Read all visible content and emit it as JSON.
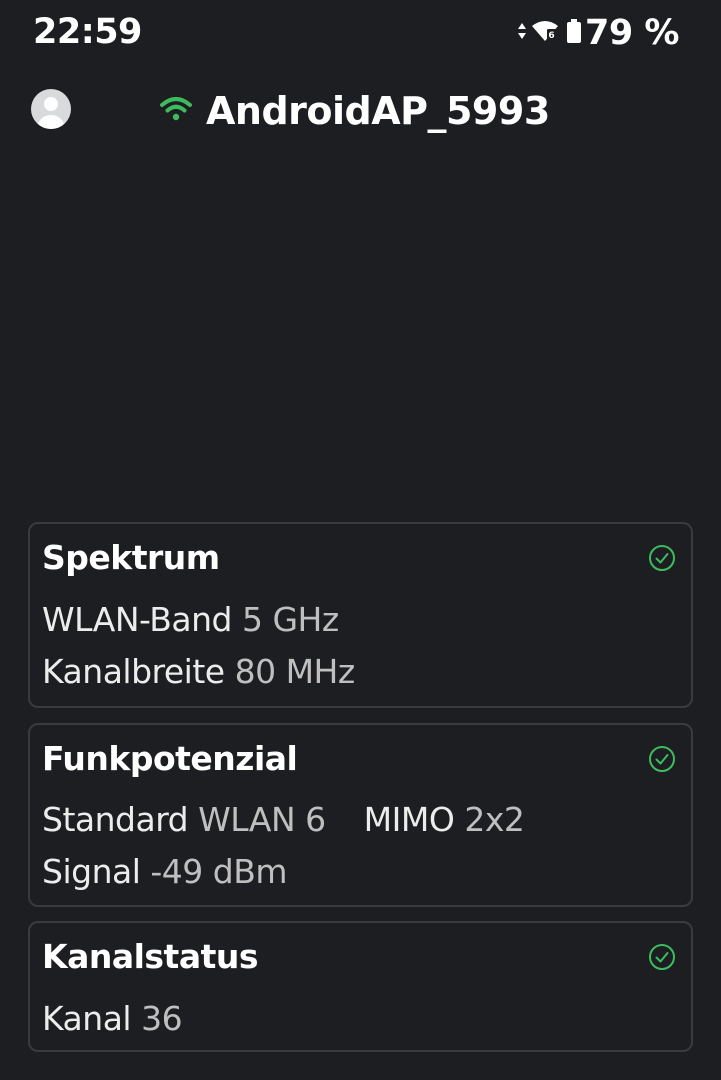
{
  "status_bar": {
    "time": "22:59",
    "battery": "79 %",
    "icons": [
      "data-arrows-icon",
      "wifi-6-icon",
      "battery-icon"
    ]
  },
  "header": {
    "ssid": "AndroidAP_5993",
    "wifi_color": "#3dbb5f"
  },
  "cards": {
    "spectrum": {
      "title": "Spektrum",
      "band_label": "WLAN-Band",
      "band_value": "5 GHz",
      "width_label": "Kanalbreite",
      "width_value": "80 MHz"
    },
    "radio": {
      "title": "Funkpotenzial",
      "standard_label": "Standard",
      "standard_value": "WLAN 6",
      "mimo_label": "MIMO",
      "mimo_value": "2x2",
      "signal_label": "Signal",
      "signal_value": "-49 dBm"
    },
    "channel": {
      "title": "Kanalstatus",
      "channel_label": "Kanal",
      "channel_value": "36"
    }
  },
  "colors": {
    "background": "#1d1e21",
    "card_border": "#3a3b3f",
    "check_green": "#3dbb5f"
  }
}
